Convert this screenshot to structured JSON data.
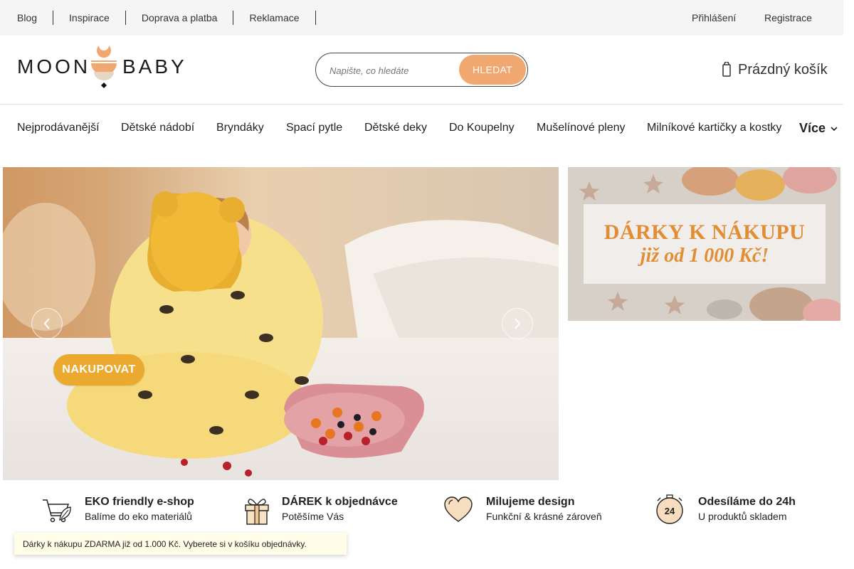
{
  "topbar": {
    "links": [
      "Blog",
      "Inspirace",
      "Doprava a platba",
      "Reklamace"
    ],
    "login": "Přihlášení",
    "register": "Registrace"
  },
  "header": {
    "logo_left": "MOON",
    "logo_right": "BABY",
    "search_placeholder": "Napište, co hledáte",
    "search_button": "HLEDAT",
    "cart_label": "Prázdný košík"
  },
  "categories": {
    "items": [
      "Nejprodávanější",
      "Dětské nádobí",
      "Bryndáky",
      "Spací pytle",
      "Dětské deky",
      "Do Koupelny",
      "Mušelínové pleny",
      "Milníkové kartičky a kostky"
    ],
    "more": "Více"
  },
  "hero": {
    "button": "NAKUPOVAT"
  },
  "promo": {
    "line1": "DÁRKY K NÁKUPU",
    "line2": "již od 1 000 Kč!"
  },
  "features": [
    {
      "title": "EKO friendly e-shop",
      "subtitle": "Balíme do eko materiálů",
      "icon": "eco-cart-icon"
    },
    {
      "title": "DÁREK k objednávce",
      "subtitle": "Potěšíme Vás",
      "icon": "gift-icon"
    },
    {
      "title": "Milujeme design",
      "subtitle": "Funkční & krásné zároveň",
      "icon": "heart-icon"
    },
    {
      "title": "Odesíláme do 24h",
      "subtitle": "U produktů skladem",
      "icon": "24h-clock-icon"
    }
  ],
  "notice": {
    "text": " Dárky k nákupu ZDARMA již od 1.000 Kč.  Vyberete si v košíku objednávky. ",
    "close": ""
  },
  "colors": {
    "accent": "#f0a870",
    "cta": "#eba930",
    "promo_text": "#e18d33",
    "topbar_bg": "#f5f5f5"
  }
}
